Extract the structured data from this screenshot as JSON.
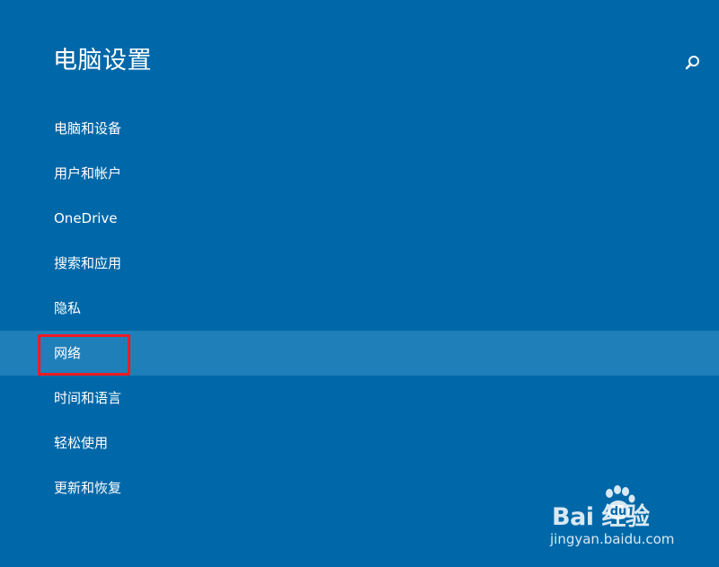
{
  "page": {
    "title": "电脑设置",
    "search_icon": "search-icon"
  },
  "nav": {
    "items": [
      {
        "label": "电脑和设备"
      },
      {
        "label": "用户和帐户"
      },
      {
        "label": "OneDrive"
      },
      {
        "label": "搜索和应用"
      },
      {
        "label": "隐私"
      },
      {
        "label": "网络",
        "selected": true
      },
      {
        "label": "时间和语言"
      },
      {
        "label": "轻松使用"
      },
      {
        "label": "更新和恢复"
      }
    ]
  },
  "watermark": {
    "logo_text": "Bai  经验",
    "url": "jingyan.baidu.com"
  },
  "colors": {
    "background": "#0068a8",
    "selected": "#1f7fb9",
    "highlight_border": "#ee1c24",
    "text": "#ffffff"
  }
}
